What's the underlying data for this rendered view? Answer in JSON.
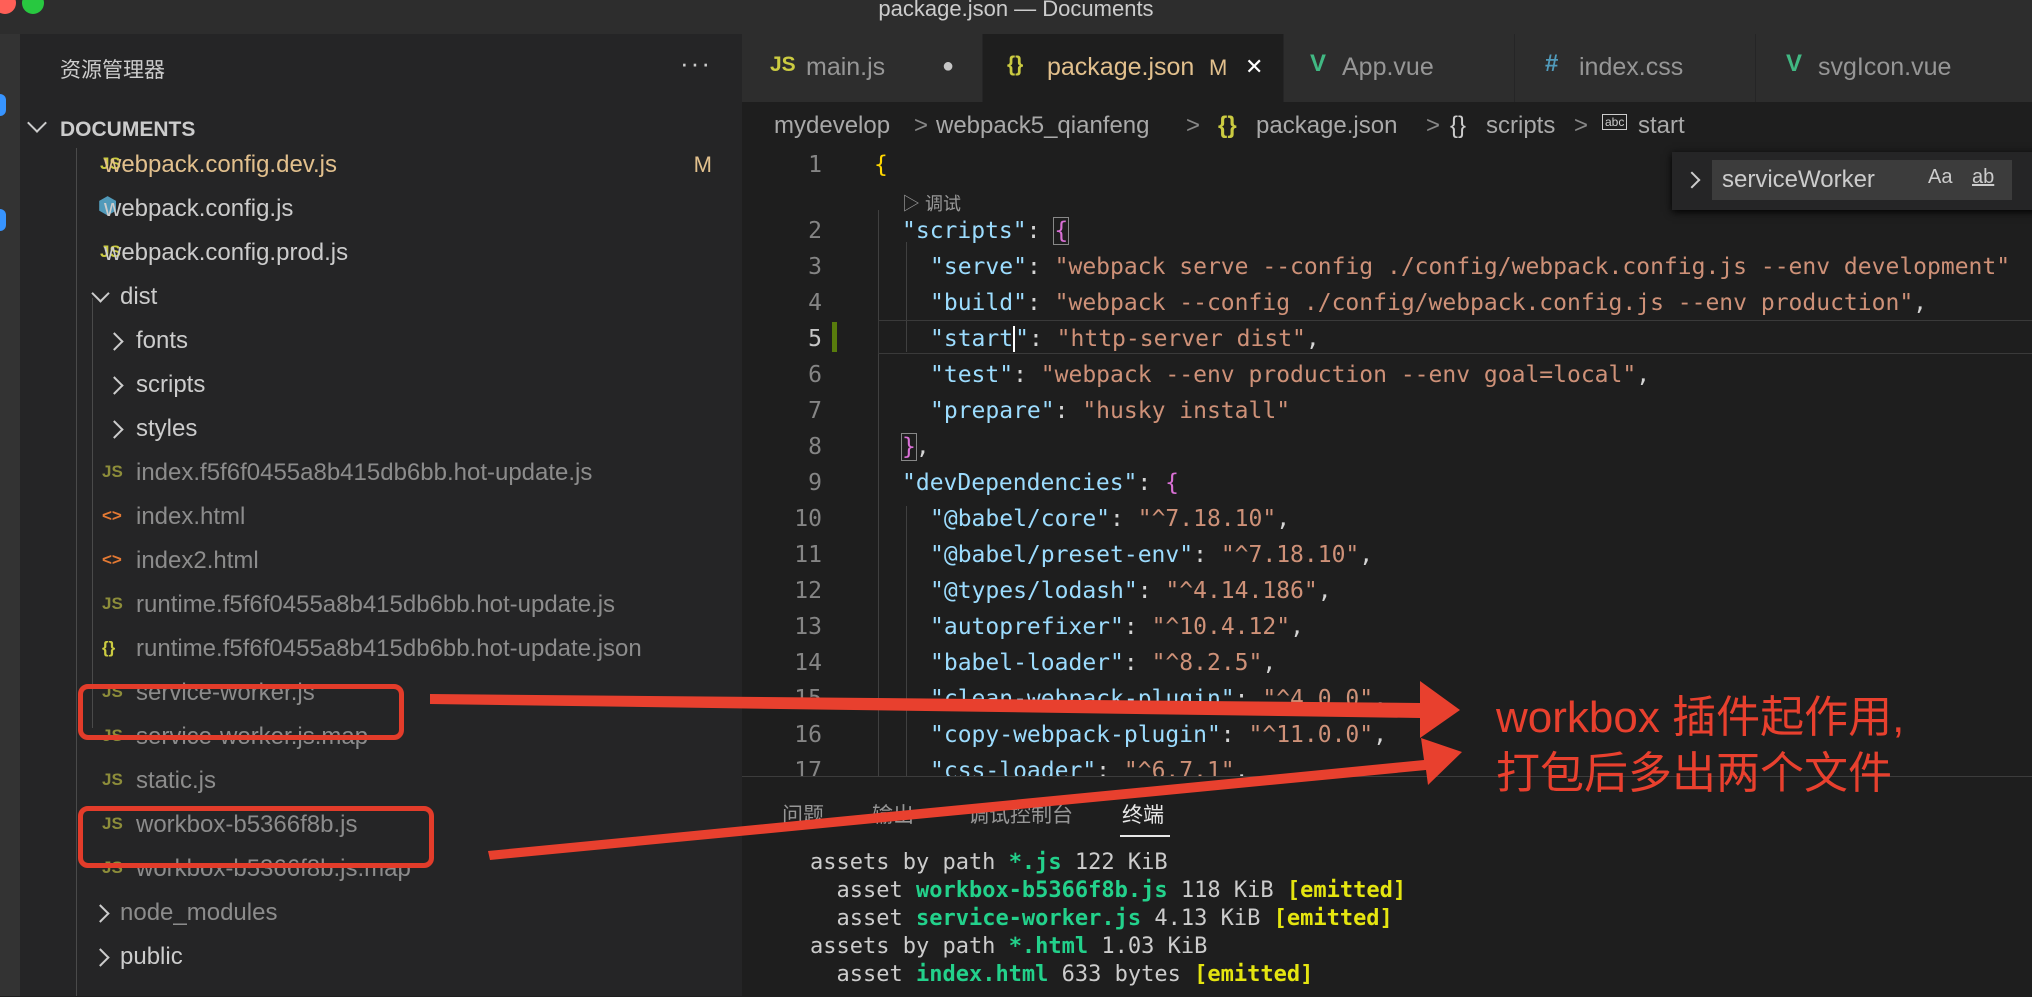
{
  "window": {
    "title": "package.json — Documents",
    "traffic_lights": [
      "#ff5f57",
      "#febc2e",
      "#28c840"
    ]
  },
  "sidebar": {
    "title": "资源管理器",
    "more": "···",
    "section": "DOCUMENTS",
    "items": [
      {
        "icon": "JS",
        "name": "webpack.config.dev.js",
        "badge": "M"
      },
      {
        "icon": "⬢",
        "name": "webpack.config.js"
      },
      {
        "icon": "JS",
        "name": "webpack.config.prod.js"
      },
      {
        "name": "dist"
      },
      {
        "name": "fonts"
      },
      {
        "name": "scripts"
      },
      {
        "name": "styles"
      },
      {
        "icon": "JS",
        "name": "index.f5f6f0455a8b415db6bb.hot-update.js"
      },
      {
        "icon": "<>",
        "name": "index.html"
      },
      {
        "icon": "<>",
        "name": "index2.html"
      },
      {
        "icon": "JS",
        "name": "runtime.f5f6f0455a8b415db6bb.hot-update.js"
      },
      {
        "icon": "{}",
        "name": "runtime.f5f6f0455a8b415db6bb.hot-update.json"
      },
      {
        "icon": "JS",
        "name": "service-worker.js"
      },
      {
        "icon": "JS",
        "name": "service-worker.js.map"
      },
      {
        "icon": "JS",
        "name": "static.js"
      },
      {
        "icon": "JS",
        "name": "workbox-b5366f8b.js"
      },
      {
        "icon": "JS",
        "name": "workbox-b5366f8b.js.map"
      },
      {
        "name": "node_modules"
      },
      {
        "name": "public"
      }
    ]
  },
  "tabs": [
    {
      "icon": "JS",
      "label": "main.js",
      "status": "●"
    },
    {
      "icon": "{}",
      "label": "package.json",
      "status": "M",
      "close": "✕"
    },
    {
      "icon": "V",
      "label": "App.vue"
    },
    {
      "icon": "#",
      "label": "index.css"
    },
    {
      "icon": "V",
      "label": "svgIcon.vue"
    }
  ],
  "breadcrumb": [
    "mydevelop",
    "webpack5_qianfeng",
    "package.json",
    "scripts",
    "start"
  ],
  "editor": {
    "codelens": "调试",
    "line_numbers": [
      "1",
      "2",
      "3",
      "4",
      "5",
      "6",
      "7",
      "8",
      "9",
      "10",
      "11",
      "12",
      "13",
      "14",
      "15",
      "16",
      "17"
    ],
    "current_line": "5"
  },
  "find": {
    "query": "serviceWorker",
    "match_case": "Aa",
    "whole_word": "ab"
  },
  "panel": {
    "tabs": [
      "问题",
      "输出",
      "调试控制台",
      "终端"
    ],
    "active": "终端"
  },
  "annotation": {
    "line1": "workbox 插件起作用,",
    "line2": "打包后多出两个文件"
  },
  "colors": {
    "accent": "#e33c2a",
    "modified": "#e2c08d",
    "string": "#ce9178",
    "key": "#9cdcfe"
  }
}
